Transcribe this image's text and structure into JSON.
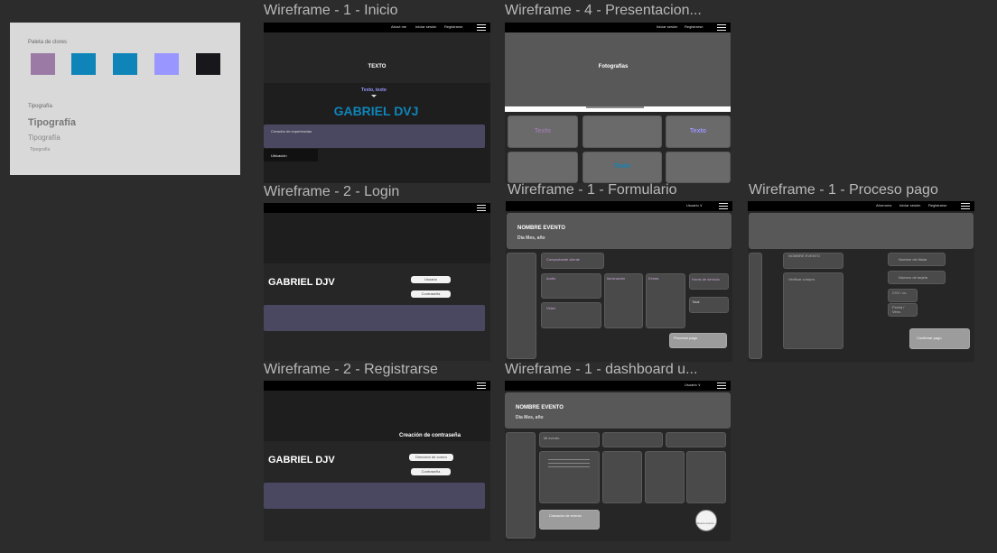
{
  "styleguide": {
    "palette_title": "Paleta de clores",
    "colors": [
      "#9c7aa6",
      "#0f84b8",
      "#0f84b8",
      "#9a96ff",
      "#17171c"
    ],
    "typography_title": "Tipografía",
    "samples": [
      "Tipografía",
      "Tipografía",
      "Tipografía"
    ]
  },
  "frames": {
    "inicio": {
      "title": "Wireframe - 1 - Inicio",
      "nav": [
        "About me",
        "Iniciar sesión",
        "Registrarse"
      ],
      "hero_text": "TEXTO",
      "subtitle": "Texto, texto",
      "brand": "GABRIEL DVJ",
      "bar_label": "Creación de experiencias",
      "location_label": "Ubicación"
    },
    "presentacion": {
      "title": "Wireframe - 4 - Presentacion...",
      "nav": [
        "Iniciar sesión",
        "Registrarse"
      ],
      "photos": "Fotografías",
      "tile_texts": [
        "Texto",
        "Texto",
        "Texto"
      ]
    },
    "login": {
      "title": "Wireframe - 2 - Login",
      "brand": "GABRIEL DJV",
      "inputs": [
        "Usuario",
        "Contraseña"
      ]
    },
    "formulario": {
      "title": "Wireframe - 1 - Formulario",
      "user": "Usuario ∨",
      "event_name": "NOMBRE EVENTO",
      "event_date": "Dia Mes, año",
      "cards": [
        "Comprobante cliente",
        "Audio",
        "Iluminación",
        "Extras",
        "Horas de servicio",
        "Video",
        "Total"
      ],
      "button": "Procesar pago"
    },
    "proceso": {
      "title": "Wireframe - 1 - Proceso pago",
      "nav": [
        "Ahorroms",
        "Iniciar sesión",
        "Registrarse"
      ],
      "fields_left": [
        "NOMBRE EVENTO",
        "Verificar compra"
      ],
      "fields_right": [
        "Nombre del titular",
        "Número de tarjeta",
        "CVV / cc",
        "Fecha / Venc."
      ],
      "button": "Confirmar pago"
    },
    "registrarse": {
      "title": "Wireframe - 2 - Registrarse",
      "heading": "Creación de contraseña",
      "brand": "GABRIEL DJV",
      "inputs": [
        "Dirección de correo",
        "Contraseña"
      ]
    },
    "dashboard": {
      "title": "Wireframe - 1 -  dashboard u...",
      "user": "Usuario ∨",
      "event_name": "NOMBRE EVENTO",
      "event_date": "Dia Mes, año",
      "tab": "Mi evento",
      "button": "Cotizador de evento",
      "fab": "Nuevo evento"
    }
  }
}
